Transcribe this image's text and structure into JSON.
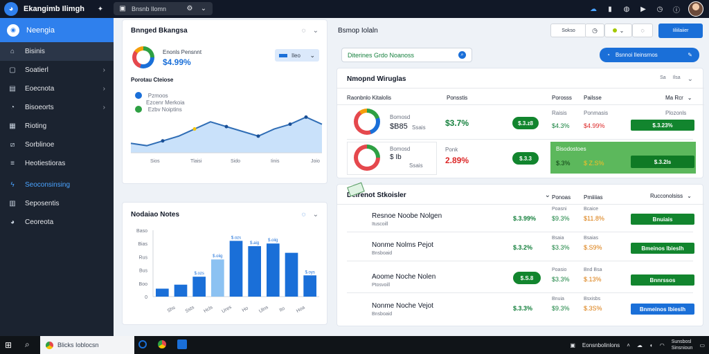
{
  "topbar": {
    "title": "Ekangimb Ilimgh",
    "url": "Bnsnb Ilomn",
    "icons": [
      "app-logo-icon",
      "gear-icon",
      "tab-icon",
      "settings-icon",
      "chevron-down-icon",
      "cloud-icon",
      "notes-icon",
      "globe-icon",
      "media-icon",
      "clock-icon",
      "info-icon"
    ]
  },
  "sidebar": {
    "header": "Neengia",
    "items": [
      {
        "label": "Bisinis",
        "icon": "home-icon"
      },
      {
        "label": "Soatierl",
        "icon": "box-icon"
      },
      {
        "label": "Eoecnota",
        "icon": "clipboard-icon"
      },
      {
        "label": "Bisoeorts",
        "icon": "chart-icon"
      },
      {
        "label": "Rioting",
        "icon": "calendar-icon"
      },
      {
        "label": "Sorblinoe",
        "icon": "chart-line-icon"
      },
      {
        "label": "Heotiestioras",
        "icon": "list-icon"
      },
      {
        "label": "Seoconsinsing",
        "icon": "bolt-icon"
      },
      {
        "label": "Seposentis",
        "icon": "bars-icon"
      },
      {
        "label": "Ceoreota",
        "icon": "pie-icon"
      }
    ]
  },
  "card1": {
    "title": "Bnnged Bkangsa",
    "kpi_label": "Enonls Pensnnt",
    "kpi_value": "$4.99%",
    "select_label": "Ileo",
    "section_label": "Porotau Cteiose",
    "legend": [
      {
        "name": "Pzmoos",
        "sub": "Ezcenr Merkoia",
        "color": "#1a6fd8"
      },
      {
        "name": "Ezbv Noiptins",
        "sub": "",
        "color": "#2ea043"
      }
    ]
  },
  "chart_line": {
    "type": "area",
    "x_ticks": [
      "Sios",
      "Tlaisi",
      "Sido",
      "Iinis",
      "Joio"
    ],
    "values": [
      4,
      3,
      5,
      7,
      10,
      13,
      11,
      9,
      7,
      10,
      12,
      15,
      12
    ],
    "ylim": [
      0,
      18
    ]
  },
  "card2": {
    "title": "Nodaiao Notes",
    "chart_data": {
      "type": "bar",
      "y_ticks": [
        "0",
        "Boo",
        "Bus",
        "Rus",
        "Bias",
        "Baso"
      ],
      "values": [
        6,
        9,
        15,
        28,
        42,
        38,
        40,
        33,
        16
      ],
      "labels": [
        "",
        "",
        "$.ozs",
        "$.oiig",
        "$.ozs",
        "$.aig",
        "$.oiig",
        "",
        "$.oys"
      ],
      "colors": [
        "#1a6fd8",
        "#1a6fd8",
        "#1a6fd8",
        "#8cc2f2",
        "#1a6fd8",
        "#1a6fd8",
        "#1a6fd8",
        "#1a6fd8",
        "#1a6fd8"
      ],
      "x_ticks": [
        "Shs",
        "Ssts",
        "Hcls",
        "Ures",
        "Ho",
        "Ulns",
        "Ito",
        "Hoa"
      ],
      "ylim": [
        0,
        50
      ]
    }
  },
  "right_header": {
    "title": "Bsmop Iolaln",
    "btn1": "Sokso",
    "btn2": "Iiliilaiier",
    "search_value": "Diterines Grdo Noanoss",
    "action_button": "Bsnnoi Ileinsrnos"
  },
  "card3": {
    "title": "Nmopnd Wiruglas",
    "cols": [
      "Raonbnlo Kitalolis",
      "Ponsstis",
      "Porosss",
      "Pailsse",
      "Ma Rcr"
    ],
    "rows": [
      {
        "name": "Bomosd",
        "value": "$B85",
        "unit": "Ssais",
        "pct": "$3.7%",
        "pct_color": "green",
        "pill": "$.3.z8",
        "c3a": "Raisis",
        "c3b": "$4.3%",
        "c4a": "Ponmasis",
        "c4b": "$4.99%",
        "c5a": "Plozonls",
        "c5b": "$.3.23%"
      },
      {
        "name": "Bomosd",
        "value": "$ Ib",
        "unit": "Ssais",
        "pct": "2.89%",
        "pct_color": "red",
        "label": "Ponk",
        "pill": "$.3.3",
        "c3a": "Bisodostoes",
        "c3b": "$.3%",
        "c4b": "$ Z.S%",
        "c5b": "$.3.2ls"
      }
    ]
  },
  "card4": {
    "title": "Delrenot Stkoisler",
    "cols": [
      "Ponoas",
      "Pmiiiias",
      "Rucconolsiss"
    ],
    "rows": [
      {
        "name": "Resnoe Noobe Nolgen",
        "sub": "Ituscoill",
        "pct": "$.3.99%",
        "c3a": "Poasni",
        "c3b": "$9.3%",
        "c4a": "Bcaice",
        "c4b": "$11.8%",
        "pill": "Bnuiais",
        "pill_color": "green"
      },
      {
        "name": "Nonme Nolms Pejot",
        "sub": "Bnsboaid",
        "pct": "$.3.2%",
        "c3a": "Bsaia",
        "c3b": "$3.3%",
        "c4a": "Bsaias",
        "c4b": "$.S9%",
        "pill": "Bmeinos lbieslh",
        "pill_color": "green"
      },
      {
        "name": "Aoome Noche Nolen",
        "sub": "Ptosvoill",
        "pill_mid": "$.S.8",
        "c3a": "Poasio",
        "c3b": "$3.3%",
        "c4a": "Bnd Bsa",
        "c4b": "$.13%",
        "pill": "Bnnrssos",
        "pill_color": "green"
      },
      {
        "name": "Nonme Noche Vejot",
        "sub": "Bnsboaid",
        "pct": "$.3.3%",
        "c3a": "Bnuia",
        "c3b": "$9.3%",
        "c4a": "Bsxisbs",
        "c4b": "$.3S%",
        "pill": "Bnmeinos lbieslh",
        "pill_color": "blue"
      }
    ]
  },
  "taskbar": {
    "search": "Blicks Ioblocsn",
    "tray_label": "Eonsnbolinlons",
    "time": "Sunsbosl",
    "date": "Sinsnioun"
  }
}
